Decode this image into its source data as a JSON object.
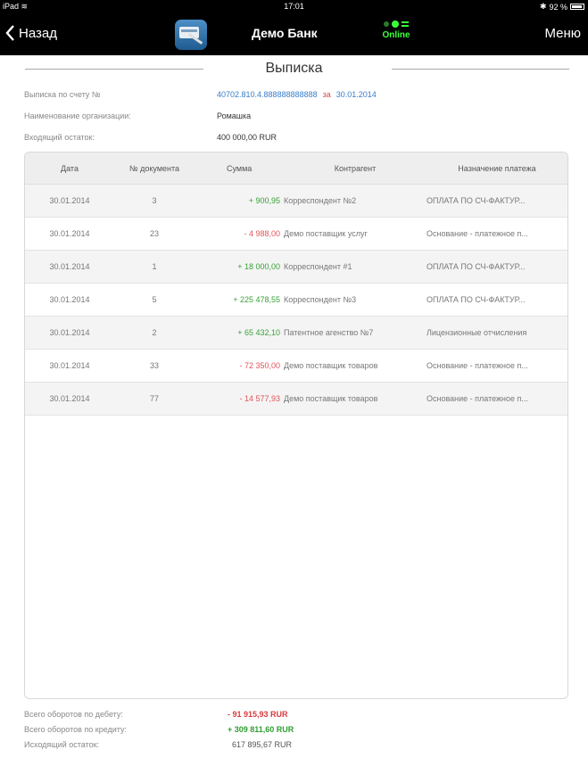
{
  "status_bar": {
    "device": "iPad",
    "time": "17:01",
    "battery": "92 %",
    "battery_level": 0.92
  },
  "nav": {
    "back_label": "Назад",
    "title": "Демо Банк",
    "online_label": "Online",
    "menu_label": "Меню"
  },
  "page": {
    "title": "Выписка"
  },
  "info": {
    "account_label": "Выписка по счету №",
    "account_number": "40702.810.4.888888888888",
    "account_for": "за",
    "account_date": "30.01.2014",
    "org_label": "Наименование организации:",
    "org_value": "Ромашка",
    "opening_label": "Входящий остаток:",
    "opening_value": "400 000,00 RUR"
  },
  "table": {
    "headers": [
      "Дата",
      "№ документа",
      "Сумма",
      "Контрагент",
      "Назначение платежа"
    ],
    "rows": [
      {
        "date": "30.01.2014",
        "doc": "3",
        "amount": "+ 900,95",
        "sign": "pos",
        "counterparty": "Корреспондент №2",
        "purpose": "ОПЛАТА ПО СЧ-ФАКТУР..."
      },
      {
        "date": "30.01.2014",
        "doc": "23",
        "amount": "- 4 988,00",
        "sign": "neg",
        "counterparty": "Демо поставщик услуг",
        "purpose": "Основание - платежное п..."
      },
      {
        "date": "30.01.2014",
        "doc": "1",
        "amount": "+ 18 000,00",
        "sign": "pos",
        "counterparty": "Корреспондент #1",
        "purpose": "ОПЛАТА ПО СЧ-ФАКТУР..."
      },
      {
        "date": "30.01.2014",
        "doc": "5",
        "amount": "+ 225 478,55",
        "sign": "pos",
        "counterparty": "Корреспондент №3",
        "purpose": "ОПЛАТА ПО СЧ-ФАКТУР..."
      },
      {
        "date": "30.01.2014",
        "doc": "2",
        "amount": "+ 65 432,10",
        "sign": "pos",
        "counterparty": "Патентное агенство №7",
        "purpose": "Лицензионные отчисления"
      },
      {
        "date": "30.01.2014",
        "doc": "33",
        "amount": "- 72 350,00",
        "sign": "neg",
        "counterparty": "Демо поставщик товаров",
        "purpose": "Основание - платежное п..."
      },
      {
        "date": "30.01.2014",
        "doc": "77",
        "amount": "- 14 577,93",
        "sign": "neg",
        "counterparty": "Демо поставщик товаров",
        "purpose": "Основание - платежное п..."
      }
    ]
  },
  "totals": {
    "debit_label": "Всего оборотов по дебету:",
    "debit_value": "- 91 915,93 RUR",
    "credit_label": "Всего оборотов по кредиту:",
    "credit_value": "+ 309 811,60 RUR",
    "closing_label": "Исходящий остаток:",
    "closing_value": "617 895,67 RUR"
  }
}
